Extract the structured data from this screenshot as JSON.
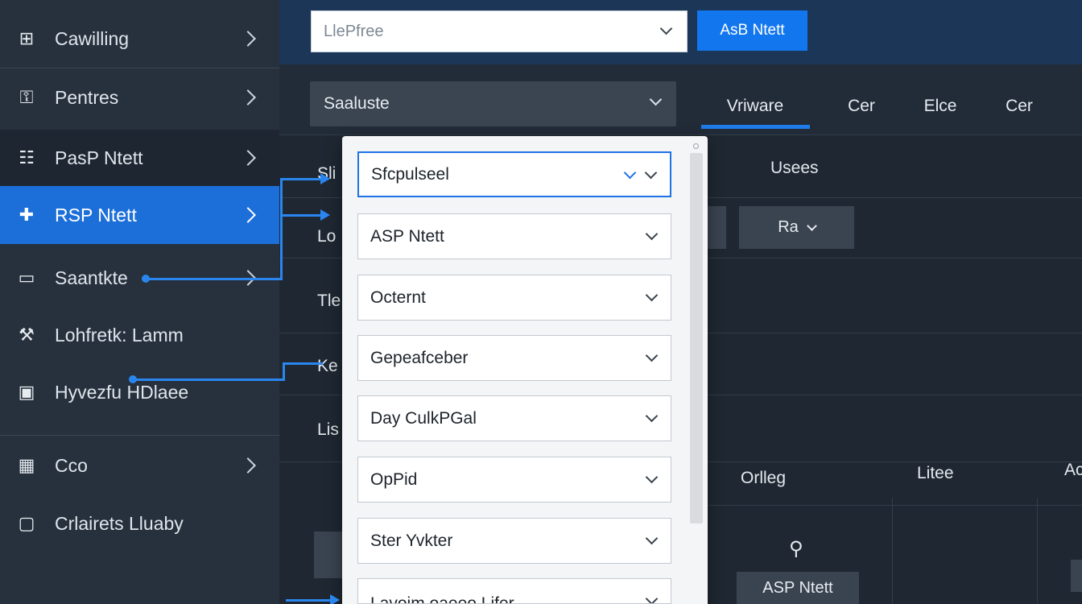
{
  "colors": {
    "accent": "#1c6fd9",
    "topbar": "#1b3656",
    "sidebar": "#27313d"
  },
  "sidebar": {
    "items": [
      {
        "label": "Cawilling",
        "icon": "grid-icon"
      },
      {
        "label": "Pentres",
        "icon": "lock-icon"
      },
      {
        "label": "PasP Ntett",
        "icon": "ladder-icon"
      },
      {
        "label": "RSP Ntett",
        "icon": "plus-icon"
      },
      {
        "label": "Saantkte",
        "icon": "monitor-icon"
      },
      {
        "label": "Lohfretk: Lamm",
        "icon": "wrench-icon"
      },
      {
        "label": "Hyvezfu HDlaee",
        "icon": "device-icon"
      },
      {
        "label": "Cco",
        "icon": "table-icon"
      },
      {
        "label": "Crlairets Lluaby",
        "icon": "folder-icon"
      }
    ]
  },
  "topbar": {
    "select_value": "LlePfree",
    "button_label": "AsB Ntett"
  },
  "toolbar": {
    "select_value": "Saaluste",
    "tabs": [
      "Vriware",
      "Cer",
      "Elce",
      "Cer"
    ]
  },
  "content": {
    "row_labels": [
      "Sli",
      "Lo",
      "Tle",
      "Ke",
      "Lis"
    ],
    "users_header": "Usees",
    "ra_button": "Ra",
    "col_headers": [
      "Orlleg",
      "Litee",
      "Ac"
    ],
    "bottom_button": "ASP Ntett",
    "link_glyph": "⚲"
  },
  "dropdown": {
    "options": [
      "Sfcpulseel",
      "ASP Ntett",
      "Octernt",
      "Gepeafceber",
      "Day CulkPGal",
      "OpPid",
      "Ster Yvkter",
      "Lavoim oaeeo Lifer"
    ]
  }
}
